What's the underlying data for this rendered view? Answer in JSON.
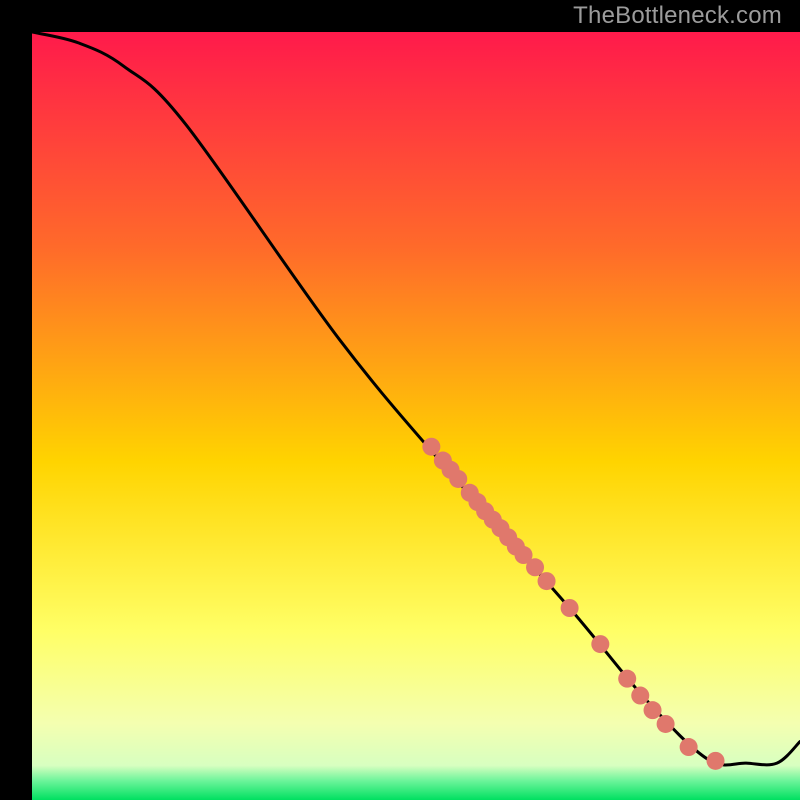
{
  "watermark": "TheBottleneck.com",
  "colors": {
    "gradient_top": "#ff1a4b",
    "gradient_mid1": "#ff6a2a",
    "gradient_mid2": "#ffd400",
    "gradient_mid3": "#ffff66",
    "gradient_mid4": "#f4ffb0",
    "gradient_bottom": "#00e060",
    "line": "#000000",
    "marker": "#e0786c",
    "frame": "#000000"
  },
  "chart_data": {
    "type": "line",
    "title": "",
    "xlabel": "",
    "ylabel": "",
    "xlim": [
      0,
      100
    ],
    "ylim": [
      0,
      100
    ],
    "line": [
      {
        "x": 0,
        "y": 100
      },
      {
        "x": 6,
        "y": 98.6
      },
      {
        "x": 12,
        "y": 95.5
      },
      {
        "x": 20,
        "y": 88
      },
      {
        "x": 40,
        "y": 60
      },
      {
        "x": 55,
        "y": 42
      },
      {
        "x": 70,
        "y": 25
      },
      {
        "x": 80,
        "y": 13
      },
      {
        "x": 88,
        "y": 5.3
      },
      {
        "x": 93,
        "y": 4.8
      },
      {
        "x": 97,
        "y": 4.8
      },
      {
        "x": 100,
        "y": 7.6
      }
    ],
    "markers": [
      {
        "x": 52.0,
        "y": 46.0
      },
      {
        "x": 53.5,
        "y": 44.2
      },
      {
        "x": 54.5,
        "y": 43.0
      },
      {
        "x": 55.5,
        "y": 41.8
      },
      {
        "x": 57.0,
        "y": 40.0
      },
      {
        "x": 58.0,
        "y": 38.8
      },
      {
        "x": 59.0,
        "y": 37.6
      },
      {
        "x": 60.0,
        "y": 36.5
      },
      {
        "x": 61.0,
        "y": 35.4
      },
      {
        "x": 62.0,
        "y": 34.2
      },
      {
        "x": 63.0,
        "y": 33.0
      },
      {
        "x": 64.0,
        "y": 31.9
      },
      {
        "x": 65.5,
        "y": 30.3
      },
      {
        "x": 67.0,
        "y": 28.5
      },
      {
        "x": 70.0,
        "y": 25.0
      },
      {
        "x": 74.0,
        "y": 20.3
      },
      {
        "x": 77.5,
        "y": 15.8
      },
      {
        "x": 79.2,
        "y": 13.6
      },
      {
        "x": 80.8,
        "y": 11.7
      },
      {
        "x": 82.5,
        "y": 9.9
      },
      {
        "x": 85.5,
        "y": 6.9
      },
      {
        "x": 89.0,
        "y": 5.1
      }
    ]
  }
}
